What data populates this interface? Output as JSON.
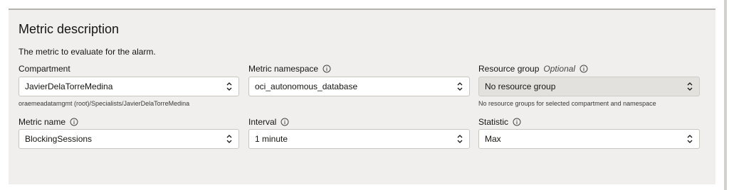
{
  "section": {
    "title": "Metric description",
    "description": "The metric to evaluate for the alarm."
  },
  "compartment": {
    "label": "Compartment",
    "value": "JavierDelaTorreMedina",
    "hint": "oraemeadatamgmt (root)/Specialists/JavierDelaTorreMedina"
  },
  "metric_namespace": {
    "label": "Metric namespace",
    "value": "oci_autonomous_database"
  },
  "resource_group": {
    "label": "Resource group",
    "optional": "Optional",
    "value": "No resource group",
    "hint": "No resource groups for selected compartment and namespace"
  },
  "metric_name": {
    "label": "Metric name",
    "value": "BlockingSessions"
  },
  "interval": {
    "label": "Interval",
    "value": "1 minute"
  },
  "statistic": {
    "label": "Statistic",
    "value": "Max"
  },
  "icons": {
    "info": "info-circle-icon",
    "chevron": "up-down-chevron-icon"
  },
  "colors": {
    "panel_bg": "#f1efed",
    "input_border": "#c9c6c2",
    "disabled_bg": "#e3e1de"
  }
}
